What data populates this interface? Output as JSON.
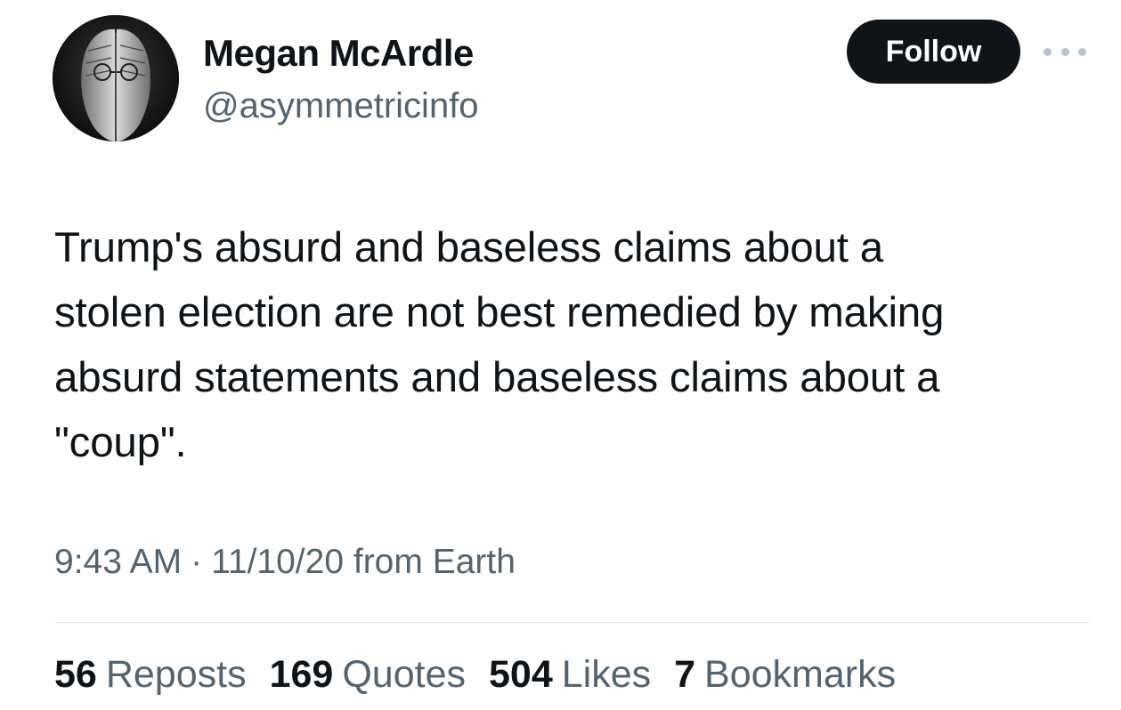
{
  "author": {
    "display_name": "Megan McArdle",
    "handle": "@asymmetricinfo",
    "avatar_icon": "profile-photo"
  },
  "actions": {
    "follow_label": "Follow",
    "more_icon": "ellipsis-icon"
  },
  "tweet": {
    "text": "Trump's absurd and baseless claims about a\nstolen election are not best remedied by making\nabsurd statements and baseless claims about a\n\"coup\"."
  },
  "meta": {
    "time": "9:43 AM",
    "separator": "·",
    "date": "11/10/20",
    "source": "from Earth"
  },
  "stats": {
    "reposts": {
      "count": "56",
      "label": "Reposts"
    },
    "quotes": {
      "count": "169",
      "label": "Quotes"
    },
    "likes": {
      "count": "504",
      "label": "Likes"
    },
    "bookmarks": {
      "count": "7",
      "label": "Bookmarks"
    }
  },
  "colors": {
    "text_primary": "#0f1419",
    "text_secondary": "#536471",
    "follow_button_bg": "#0f1419",
    "follow_button_text": "#ffffff",
    "divider": "#e1e8ed"
  }
}
